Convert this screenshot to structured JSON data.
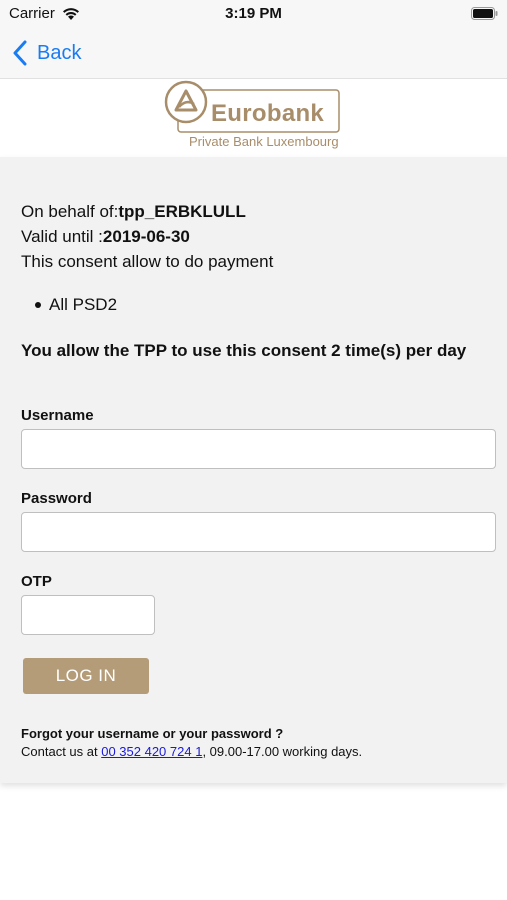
{
  "status_bar": {
    "carrier": "Carrier",
    "time": "3:19 PM",
    "wifi_icon": "wifi-icon",
    "battery_icon": "battery-icon"
  },
  "nav": {
    "back_label": "Back",
    "back_icon": "chevron-left-icon",
    "accent_color": "#1a7cf2"
  },
  "logo": {
    "wordmark": "Eurobank",
    "tagline": "Private Bank Luxembourg",
    "brand_color": "#a88d6a"
  },
  "consent": {
    "on_behalf_prefix": "On behalf of:",
    "on_behalf_value": "tpp_ERBKLULL",
    "valid_until_prefix": "Valid until :",
    "valid_until_value": "2019-06-30",
    "allow_text": "This consent allow to do payment",
    "scopes": [
      "All PSD2"
    ],
    "usage_text": "You allow the TPP to use this consent 2 time(s) per day"
  },
  "form": {
    "username_label": "Username",
    "username_value": "",
    "password_label": "Password",
    "password_value": "",
    "otp_label": "OTP",
    "otp_value": "",
    "login_label": "LOG IN",
    "button_color": "#b59c78"
  },
  "help": {
    "forgot_title": "Forgot your username or your password ?",
    "contact_prefix": "Contact us at ",
    "contact_phone": "00 352 420 724 1",
    "contact_suffix": ", 09.00-17.00 working days."
  }
}
